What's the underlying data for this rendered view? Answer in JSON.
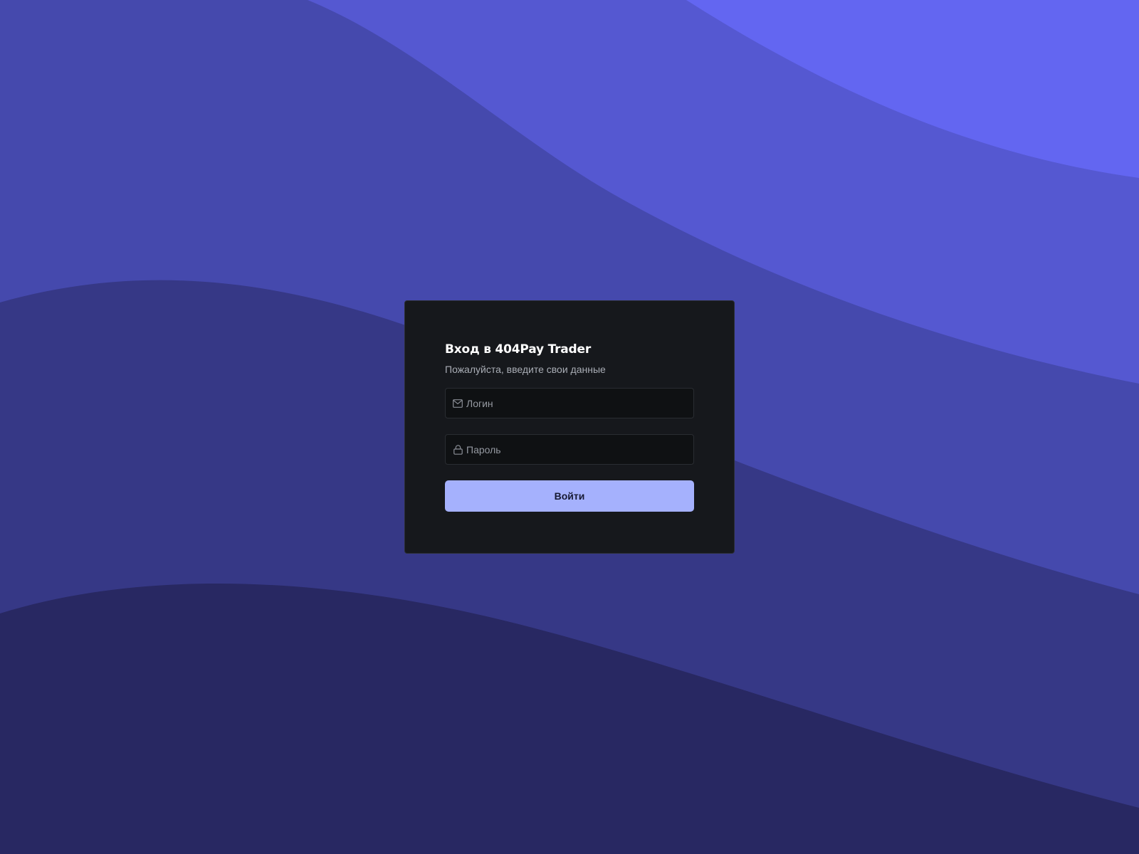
{
  "login": {
    "title": "Вход в 404Pay Trader",
    "subtitle": "Пожалуйста, введите свои данные",
    "login_field": {
      "value": "",
      "placeholder": "Логин",
      "icon": "mail-icon"
    },
    "password_field": {
      "value": "",
      "placeholder": "Пароль",
      "icon": "lock-icon"
    },
    "submit_label": "Войти"
  },
  "colors": {
    "background_darkest": "#282862",
    "wave_dark": "#363886",
    "wave_mid": "#4549ad",
    "wave_light": "#5558d1",
    "wave_lightest": "#6366f1",
    "card_bg": "#16181c",
    "button_bg": "#a5b1fd",
    "button_text": "#171a33"
  }
}
